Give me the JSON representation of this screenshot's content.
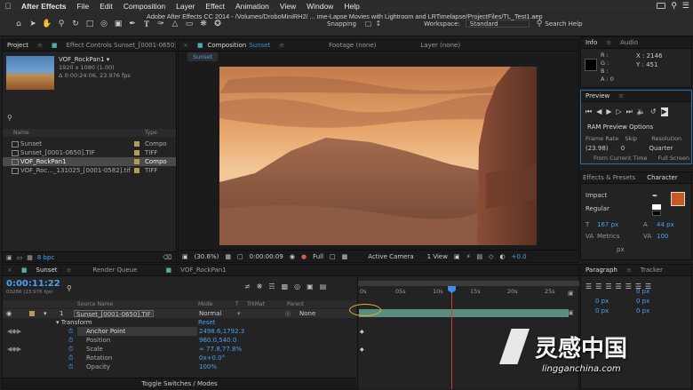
{
  "menubar": {
    "items": [
      "After Effects",
      "File",
      "Edit",
      "Composition",
      "Layer",
      "Effect",
      "Animation",
      "View",
      "Window",
      "Help"
    ]
  },
  "titlebar": {
    "title": "Adobe After Effects CC 2014 - /Volumes/DroboMiniRH2/ ... ime-Lapse Movies with Lightroom and LRTimelapse/ProjectFiles/TL_Test1.aep"
  },
  "toolbar": {
    "snapping": "Snapping",
    "workspace_label": "Workspace:",
    "workspace_value": "Standard",
    "search_help": "Search Help"
  },
  "project": {
    "tab": "Project",
    "effect_controls_tab": "Effect Controls Sunset_[0001-0650]",
    "item_name": "VOF_RockPan1 ▾",
    "item_line1": "1920 x 1080 (1.00)",
    "item_line2": "Δ 0:00:24:06, 23.976 fps",
    "col_name": "Name",
    "col_type": "Type",
    "items": [
      {
        "name": "Sunset",
        "type": "Compo",
        "color": "#b79a58"
      },
      {
        "name": "Sunset_[0001-0650].TIF",
        "type": "TIFF",
        "color": "#b79a58"
      },
      {
        "name": "VOF_RockPan1",
        "type": "Compo",
        "color": "#b79a58"
      },
      {
        "name": "VOF_Roc..._131025_[0001-0582].tif",
        "type": "TIFF",
        "color": "#b79a58"
      }
    ],
    "bpc": "8 bpc"
  },
  "comp": {
    "tab_label": "Composition",
    "tab_name": "Sunset",
    "footage_tab": "Footage (none)",
    "layer_tab": "Layer (none)",
    "sub_tab": "Sunset",
    "zoom": "(30.6%)",
    "time": "0:00:00:09",
    "resolution": "Full",
    "camera": "Active Camera",
    "view": "1 View",
    "exposure": "+0.0"
  },
  "info": {
    "tab": "Info",
    "audio_tab": "Audio",
    "r": "R :",
    "g": "G :",
    "b": "B :",
    "a": "A : 0",
    "x": "X : 2146",
    "y": "Y : 451"
  },
  "preview": {
    "tab": "Preview",
    "ram_options": "RAM Preview Options",
    "frame_rate_label": "Frame Rate",
    "skip_label": "Skip",
    "resolution_label": "Resolution",
    "frame_rate_value": "(23.98)",
    "skip_value": "0",
    "resolution_value": "Quarter",
    "from_current": "From Current Time",
    "full_screen": "Full Screen"
  },
  "character": {
    "effects_tab": "Effects & Presets",
    "tab": "Character",
    "font": "Impact",
    "style": "Regular",
    "size": "167 px",
    "leading": "44 px",
    "kerning": "Metrics",
    "tracking": "100",
    "unit": "px",
    "fill_color": "#c65a22"
  },
  "paragraph": {
    "tab": "Paragraph",
    "tracker_tab": "Tracker",
    "val1": "0 px",
    "val2": "0 px",
    "val3": "0 px",
    "val4": "0 px",
    "val5": "0 px"
  },
  "timeline": {
    "tab_sunset": "Sunset",
    "tab_render": "Render Queue",
    "tab_rockpan": "VOF_RockPan1",
    "timecode": "0:00:11:22",
    "frame_info": "00286 (23.976 fps)",
    "col_source": "Source Name",
    "col_mode": "Mode",
    "col_t": "T",
    "col_trkmat": "TrkMat",
    "col_parent": "Parent",
    "layer_num": "1",
    "layer_name": "Sunset_[0001-0650].TIF",
    "layer_mode": "Normal",
    "layer_parent": "None",
    "transform": "Transform",
    "reset": "Reset",
    "props": [
      {
        "name": "Anchor Point",
        "value": "2498.6,1792.3"
      },
      {
        "name": "Position",
        "value": "960.0,540.0"
      },
      {
        "name": "Scale",
        "value": "∞ 77.8,77.8%"
      },
      {
        "name": "Rotation",
        "value": "0x+0.0°"
      },
      {
        "name": "Opacity",
        "value": "100%"
      }
    ],
    "toggle": "Toggle Switches / Modes",
    "ruler": [
      "0s",
      "05s",
      "10s",
      "15s",
      "20s",
      "25s"
    ]
  },
  "watermark": {
    "brand": "灵感中国",
    "url": "lingganchina.com"
  }
}
